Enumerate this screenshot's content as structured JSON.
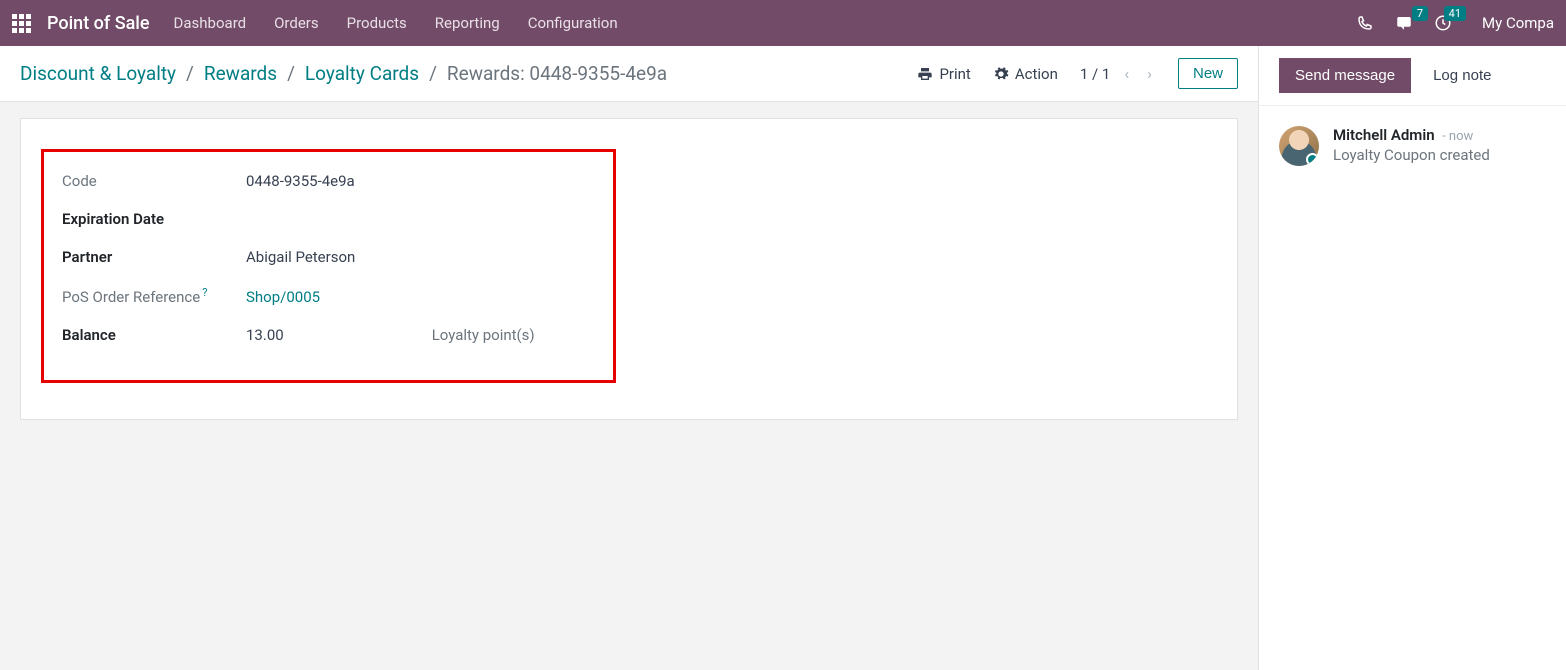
{
  "topbar": {
    "brand": "Point of Sale",
    "nav": [
      "Dashboard",
      "Orders",
      "Products",
      "Reporting",
      "Configuration"
    ],
    "messages_badge": "7",
    "activities_badge": "41",
    "company": "My Compa"
  },
  "breadcrumbs": {
    "items": [
      "Discount & Loyalty",
      "Rewards",
      "Loyalty Cards"
    ],
    "current": "Rewards: 0448-9355-4e9a"
  },
  "controls": {
    "print": "Print",
    "action": "Action",
    "pager": "1 / 1",
    "new": "New"
  },
  "form": {
    "code_label": "Code",
    "code_value": "0448-9355-4e9a",
    "expiration_label": "Expiration Date",
    "partner_label": "Partner",
    "partner_value": "Abigail Peterson",
    "pos_ref_label": "PoS Order Reference",
    "pos_ref_value": "Shop/0005",
    "balance_label": "Balance",
    "balance_value": "13.00",
    "balance_unit": "Loyalty point(s)"
  },
  "chatter": {
    "send": "Send message",
    "lognote": "Log note",
    "msg_author": "Mitchell Admin",
    "msg_ts": "- now",
    "msg_body": "Loyalty Coupon created"
  }
}
